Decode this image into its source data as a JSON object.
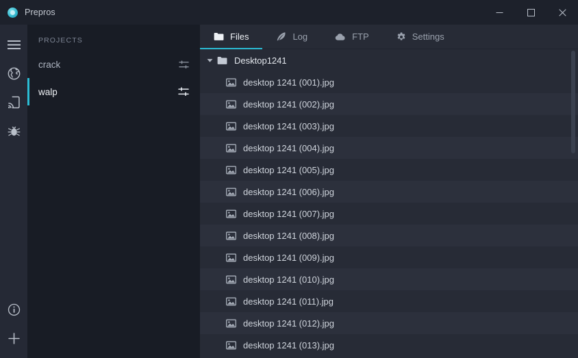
{
  "window": {
    "title": "Prepros",
    "logo_icon": "prepros-logo-icon",
    "controls": {
      "minimize": "minimize-icon",
      "maximize": "maximize-icon",
      "close": "close-icon"
    }
  },
  "rail": {
    "top_items": [
      {
        "icon": "hamburger-menu-icon",
        "name": "menu"
      },
      {
        "icon": "globe-icon",
        "name": "preview-browser"
      },
      {
        "icon": "device-sync-icon",
        "name": "remote-device-preview"
      },
      {
        "icon": "bug-icon",
        "name": "debugger"
      }
    ],
    "bottom_items": [
      {
        "icon": "info-circle-icon",
        "name": "info"
      },
      {
        "icon": "plus-icon",
        "name": "add-project"
      }
    ]
  },
  "sidebar": {
    "header": "PROJECTS",
    "items": [
      {
        "label": "crack",
        "active": false,
        "settings_icon": "sliders-icon"
      },
      {
        "label": "walp",
        "active": true,
        "settings_icon": "sliders-icon"
      }
    ]
  },
  "tabs": [
    {
      "label": "Files",
      "icon": "folder-icon",
      "active": true
    },
    {
      "label": "Log",
      "icon": "feather-icon",
      "active": false
    },
    {
      "label": "FTP",
      "icon": "cloud-icon",
      "active": false
    },
    {
      "label": "Settings",
      "icon": "gear-icon",
      "active": false
    }
  ],
  "file_tree": {
    "root": {
      "label": "Desktop1241",
      "icon": "folder-icon",
      "expanded": true,
      "chevron": "chevron-down-icon"
    },
    "files": [
      {
        "label": "desktop 1241 (001).jpg",
        "icon": "image-icon"
      },
      {
        "label": "desktop 1241 (002).jpg",
        "icon": "image-icon"
      },
      {
        "label": "desktop 1241 (003).jpg",
        "icon": "image-icon"
      },
      {
        "label": "desktop 1241 (004).jpg",
        "icon": "image-icon"
      },
      {
        "label": "desktop 1241 (005).jpg",
        "icon": "image-icon"
      },
      {
        "label": "desktop 1241 (006).jpg",
        "icon": "image-icon"
      },
      {
        "label": "desktop 1241 (007).jpg",
        "icon": "image-icon"
      },
      {
        "label": "desktop 1241 (008).jpg",
        "icon": "image-icon"
      },
      {
        "label": "desktop 1241 (009).jpg",
        "icon": "image-icon"
      },
      {
        "label": "desktop 1241 (010).jpg",
        "icon": "image-icon"
      },
      {
        "label": "desktop 1241 (011).jpg",
        "icon": "image-icon"
      },
      {
        "label": "desktop 1241 (012).jpg",
        "icon": "image-icon"
      },
      {
        "label": "desktop 1241 (013).jpg",
        "icon": "image-icon"
      }
    ]
  },
  "colors": {
    "accent": "#2bbcd4",
    "titlebar_bg": "#1d212b",
    "rail_bg": "#252935",
    "sidebar_bg": "#181c25",
    "main_bg": "#272b36",
    "row_stripe": "#2c303c"
  }
}
